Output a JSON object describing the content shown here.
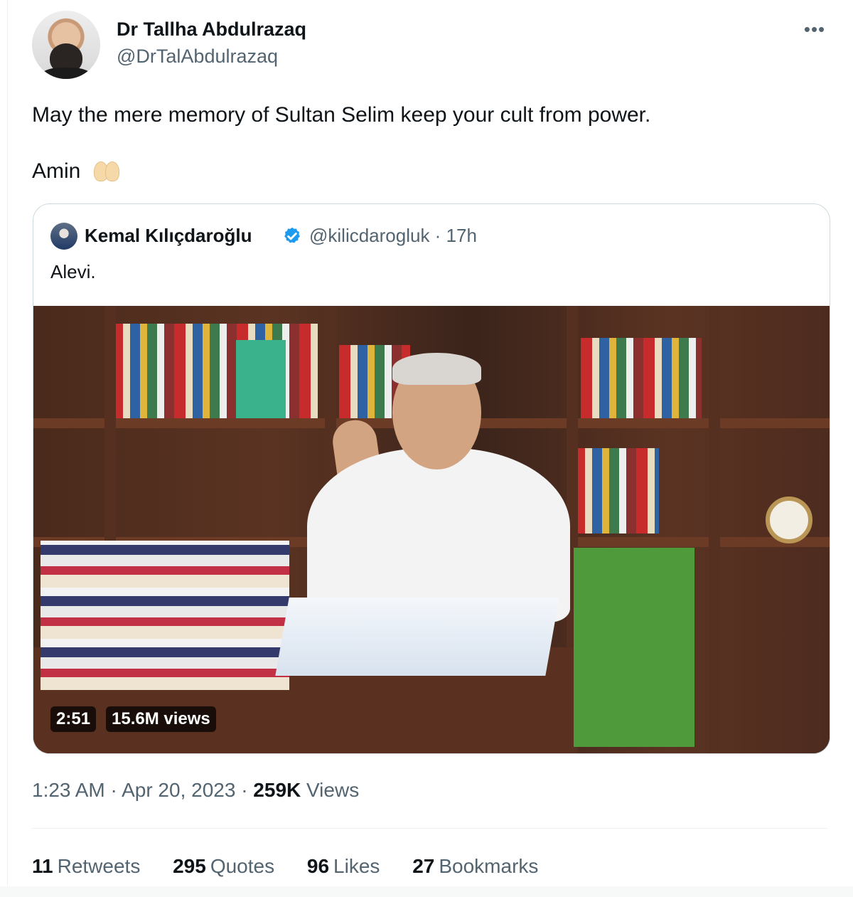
{
  "author": {
    "display_name": "Dr Tallha Abdulrazaq",
    "handle": "@DrTalAbdulrazaq"
  },
  "more_icon": "ellipsis-icon",
  "tweet": {
    "text": "May the mere memory of Sultan Selim keep your cult from power.",
    "amin": "Amin",
    "emoji": "folded-hands-icon"
  },
  "quoted": {
    "display_name": "Kemal Kılıçdaroğlu",
    "verified_icon": "verified-badge-icon",
    "handle_time": "@kilicdarogluk · 17h",
    "text": "Alevi.",
    "video": {
      "duration": "2:51",
      "views": "15.6M views"
    }
  },
  "meta": {
    "time_date": "1:23 AM · Apr 20, 2023 · ",
    "views_count": "259K",
    "views_label": " Views"
  },
  "stats": [
    {
      "count": "11",
      "label": "Retweets"
    },
    {
      "count": "295",
      "label": "Quotes"
    },
    {
      "count": "96",
      "label": "Likes"
    },
    {
      "count": "27",
      "label": "Bookmarks"
    }
  ],
  "colors": {
    "text": "#0f1419",
    "secondary": "#536471",
    "border": "#cfd9de",
    "verified": "#1d9bf0"
  }
}
